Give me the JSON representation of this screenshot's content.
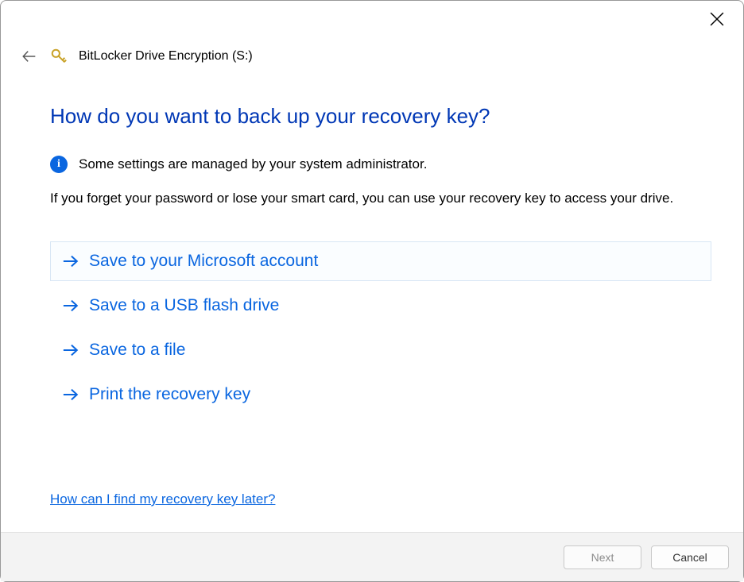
{
  "window": {
    "title": "BitLocker Drive Encryption (S:)"
  },
  "main": {
    "heading": "How do you want to back up your recovery key?",
    "info": "Some settings are managed by your system administrator.",
    "description": "If you forget your password or lose your smart card, you can use your recovery key to access your drive."
  },
  "options": {
    "ms_account": "Save to your Microsoft account",
    "usb": "Save to a USB flash drive",
    "file": "Save to a file",
    "print": "Print the recovery key"
  },
  "help_link": "How can I find my recovery key later?",
  "buttons": {
    "next": "Next",
    "cancel": "Cancel"
  }
}
